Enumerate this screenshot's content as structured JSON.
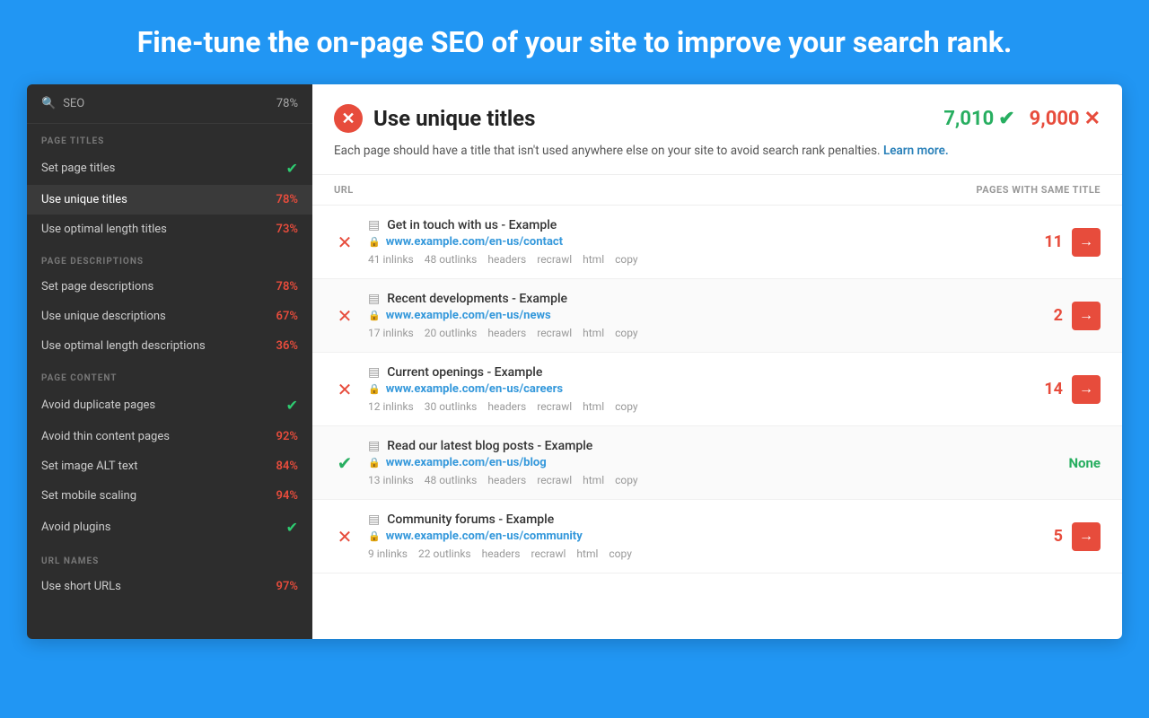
{
  "hero": {
    "title": "Fine-tune the on-page SEO of your site to improve your search rank."
  },
  "sidebar": {
    "search_label": "SEO",
    "search_score": "78%",
    "sections": [
      {
        "label": "PAGE TITLES",
        "items": [
          {
            "id": "set-page-titles",
            "label": "Set page titles",
            "score": null,
            "status": "pass"
          },
          {
            "id": "use-unique-titles",
            "label": "Use unique titles",
            "score": "78%",
            "status": "active-fail"
          },
          {
            "id": "use-optimal-length-titles",
            "label": "Use optimal length titles",
            "score": "73%",
            "status": "fail"
          }
        ]
      },
      {
        "label": "PAGE DESCRIPTIONS",
        "items": [
          {
            "id": "set-page-descriptions",
            "label": "Set page descriptions",
            "score": "78%",
            "status": "fail"
          },
          {
            "id": "use-unique-descriptions",
            "label": "Use unique descriptions",
            "score": "67%",
            "status": "fail"
          },
          {
            "id": "use-optimal-length-descriptions",
            "label": "Use optimal length descriptions",
            "score": "36%",
            "status": "fail"
          }
        ]
      },
      {
        "label": "PAGE CONTENT",
        "items": [
          {
            "id": "avoid-duplicate-pages",
            "label": "Avoid duplicate pages",
            "score": null,
            "status": "pass"
          },
          {
            "id": "avoid-thin-content-pages",
            "label": "Avoid thin content pages",
            "score": "92%",
            "status": "fail"
          },
          {
            "id": "set-image-alt-text",
            "label": "Set image ALT text",
            "score": "84%",
            "status": "fail"
          },
          {
            "id": "set-mobile-scaling",
            "label": "Set mobile scaling",
            "score": "94%",
            "status": "fail"
          },
          {
            "id": "avoid-plugins",
            "label": "Avoid plugins",
            "score": null,
            "status": "pass"
          }
        ]
      },
      {
        "label": "URL NAMES",
        "items": [
          {
            "id": "use-short-urls",
            "label": "Use short URLs",
            "score": "97%",
            "status": "fail"
          }
        ]
      }
    ]
  },
  "main": {
    "title": "Use unique titles",
    "score_pass": "7,010",
    "score_fail": "9,000",
    "description": "Each page should have a title that isn't used anywhere else on your site to avoid search rank penalties.",
    "learn_more_label": "Learn more.",
    "table_header_url": "URL",
    "table_header_pages": "PAGES WITH SAME TITLE",
    "rows": [
      {
        "id": "row-1",
        "status": "fail",
        "title": "Get in touch with us - Example",
        "url_base": "www.example.com",
        "url_bold": "/en-us/",
        "url_path": "contact",
        "inlinks": "41 inlinks",
        "outlinks": "48 outlinks",
        "headers": "headers",
        "recrawl": "recrawl",
        "html": "html",
        "copy": "copy",
        "count": "11",
        "count_type": "number"
      },
      {
        "id": "row-2",
        "status": "fail",
        "title": "Recent developments - Example",
        "url_base": "www.example.com",
        "url_bold": "/en-us/",
        "url_path": "news",
        "inlinks": "17 inlinks",
        "outlinks": "20 outlinks",
        "headers": "headers",
        "recrawl": "recrawl",
        "html": "html",
        "copy": "copy",
        "count": "2",
        "count_type": "number"
      },
      {
        "id": "row-3",
        "status": "fail",
        "title": "Current openings - Example",
        "url_base": "www.example.com",
        "url_bold": "/en-us/",
        "url_path": "careers",
        "inlinks": "12 inlinks",
        "outlinks": "30 outlinks",
        "headers": "headers",
        "recrawl": "recrawl",
        "html": "html",
        "copy": "copy",
        "count": "14",
        "count_type": "number"
      },
      {
        "id": "row-4",
        "status": "pass",
        "title": "Read our latest blog posts - Example",
        "url_base": "www.example.com",
        "url_bold": "/en-us/",
        "url_path": "blog",
        "inlinks": "13 inlinks",
        "outlinks": "48 outlinks",
        "headers": "headers",
        "recrawl": "recrawl",
        "html": "html",
        "copy": "copy",
        "count": "None",
        "count_type": "none"
      },
      {
        "id": "row-5",
        "status": "fail",
        "title": "Community forums - Example",
        "url_base": "www.example.com",
        "url_bold": "/en-us/",
        "url_path": "community",
        "inlinks": "9 inlinks",
        "outlinks": "22 outlinks",
        "headers": "headers",
        "recrawl": "recrawl",
        "html": "html",
        "copy": "copy",
        "count": "5",
        "count_type": "number"
      }
    ]
  }
}
